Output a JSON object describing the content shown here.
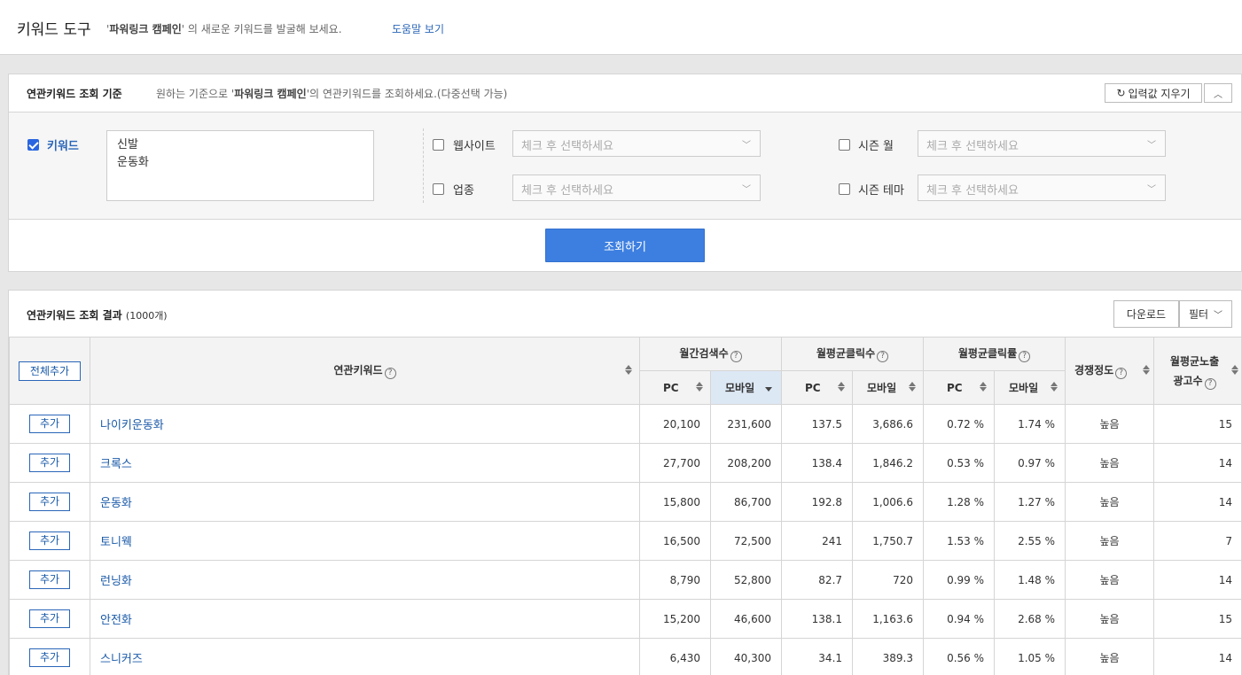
{
  "header": {
    "title": "키워드 도구",
    "desc_pre": "'",
    "desc_campaign": "파워링크 캠페인",
    "desc_post": "' 의 새로운 키워드를 발굴해 보세요.",
    "help": "도움말 보기"
  },
  "criteria": {
    "title": "연관키워드 조회 기준",
    "desc_pre": "원하는 기준으로 '",
    "desc_campaign": "파워링크 캠페인",
    "desc_post": "'의 연관키워드를 조회하세요.(다중선택 가능)",
    "reset": "입력값 지우기",
    "keyword_label": "키워드",
    "keywords": [
      "신발",
      "운동화"
    ],
    "website_label": "웹사이트",
    "industry_label": "업종",
    "season_month_label": "시즌 월",
    "season_theme_label": "시즌 테마",
    "select_placeholder": "체크 후 선택하세요",
    "search_button": "조회하기"
  },
  "results": {
    "title": "연관키워드 조회 결과",
    "count": "(1000개)",
    "download": "다운로드",
    "filter": "필터",
    "headers": {
      "add_all": "전체추가",
      "keyword": "연관키워드",
      "monthly_search": "월간검색수",
      "monthly_clicks": "월평균클릭수",
      "monthly_ctr": "월평균클릭률",
      "competition": "경쟁정도",
      "ad_count_1": "월평균노출",
      "ad_count_2": "광고수",
      "pc": "PC",
      "mobile": "모바일"
    },
    "add_label": "추가",
    "rows": [
      {
        "kw": "나이키운동화",
        "pc": "20,100",
        "mo": "231,600",
        "cpc": "137.5",
        "cmo": "3,686.6",
        "rpc": "0.72 %",
        "rmo": "1.74 %",
        "comp": "높음",
        "ads": "15"
      },
      {
        "kw": "크록스",
        "pc": "27,700",
        "mo": "208,200",
        "cpc": "138.4",
        "cmo": "1,846.2",
        "rpc": "0.53 %",
        "rmo": "0.97 %",
        "comp": "높음",
        "ads": "14"
      },
      {
        "kw": "운동화",
        "pc": "15,800",
        "mo": "86,700",
        "cpc": "192.8",
        "cmo": "1,006.6",
        "rpc": "1.28 %",
        "rmo": "1.27 %",
        "comp": "높음",
        "ads": "14"
      },
      {
        "kw": "토니웩",
        "pc": "16,500",
        "mo": "72,500",
        "cpc": "241",
        "cmo": "1,750.7",
        "rpc": "1.53 %",
        "rmo": "2.55 %",
        "comp": "높음",
        "ads": "7"
      },
      {
        "kw": "런닝화",
        "pc": "8,790",
        "mo": "52,800",
        "cpc": "82.7",
        "cmo": "720",
        "rpc": "0.99 %",
        "rmo": "1.48 %",
        "comp": "높음",
        "ads": "14"
      },
      {
        "kw": "안전화",
        "pc": "15,200",
        "mo": "46,600",
        "cpc": "138.1",
        "cmo": "1,163.6",
        "rpc": "0.94 %",
        "rmo": "2.68 %",
        "comp": "높음",
        "ads": "15"
      },
      {
        "kw": "스니커즈",
        "pc": "6,430",
        "mo": "40,300",
        "cpc": "34.1",
        "cmo": "389.3",
        "rpc": "0.56 %",
        "rmo": "1.05 %",
        "comp": "높음",
        "ads": "14"
      }
    ]
  }
}
